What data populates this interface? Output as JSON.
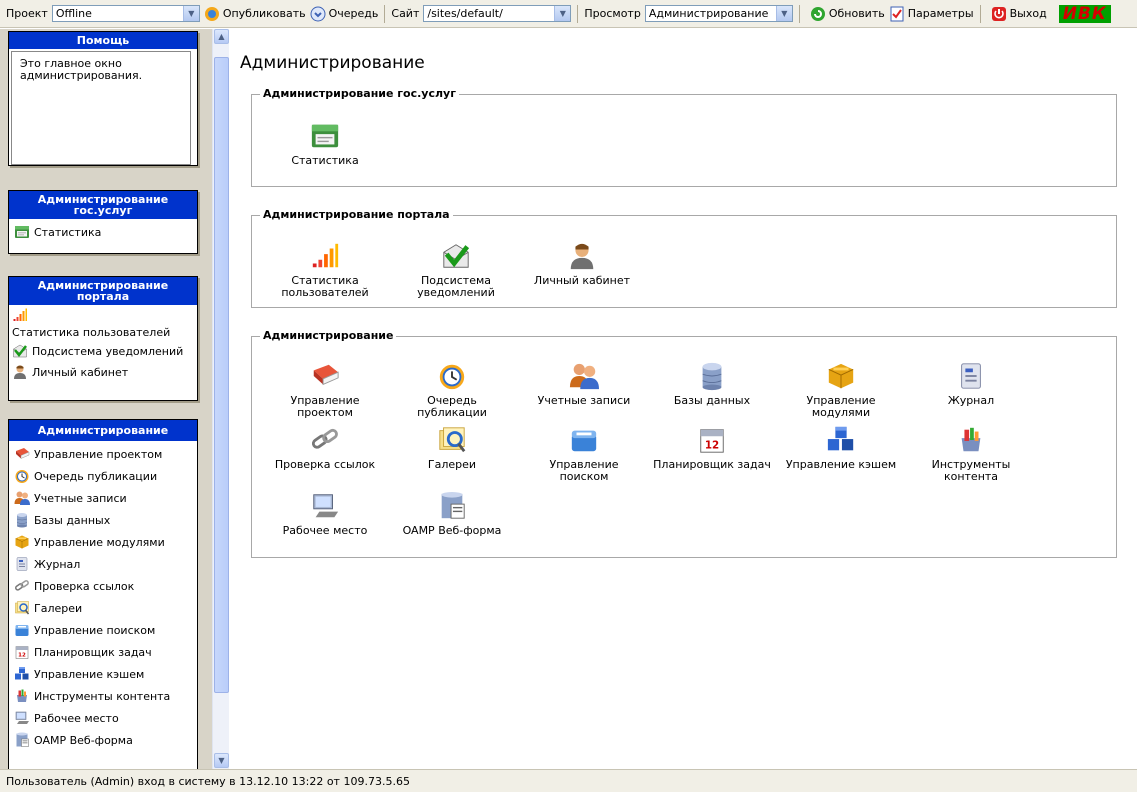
{
  "toolbar": {
    "project_label": "Проект",
    "project_value": "Offline",
    "publish_label": "Опубликовать",
    "queue_label": "Очередь",
    "site_label": "Сайт",
    "site_value": "/sites/default/",
    "view_label": "Просмотр",
    "view_value": "Администрирование",
    "refresh_label": "Обновить",
    "params_label": "Параметры",
    "exit_label": "Выход",
    "logo_text": "ИВК"
  },
  "sidebar": {
    "help": {
      "title": "Помощь",
      "text": "Это главное окно администрирования."
    },
    "gos": {
      "title": "Администрирование гос.услуг",
      "items": [
        {
          "label": "Статистика",
          "icon": "statistics-icon"
        }
      ]
    },
    "portal": {
      "title": "Администрирование портала",
      "items": [
        {
          "label": "Статистика пользователей",
          "icon": "bar-chart-icon"
        },
        {
          "label": "Подсистема уведомлений",
          "icon": "notify-icon"
        },
        {
          "label": "Личный кабинет",
          "icon": "user-icon"
        }
      ]
    },
    "admin": {
      "title": "Администрирование",
      "items": [
        {
          "label": "Управление проектом",
          "icon": "book-icon"
        },
        {
          "label": "Очередь публикации",
          "icon": "clock-icon"
        },
        {
          "label": "Учетные записи",
          "icon": "users-icon"
        },
        {
          "label": "Базы данных",
          "icon": "database-icon"
        },
        {
          "label": "Управление модулями",
          "icon": "modules-icon"
        },
        {
          "label": "Журнал",
          "icon": "journal-icon"
        },
        {
          "label": "Проверка ссылок",
          "icon": "link-icon"
        },
        {
          "label": "Галереи",
          "icon": "gallery-icon"
        },
        {
          "label": "Управление поиском",
          "icon": "search-mgmt-icon"
        },
        {
          "label": "Планировщик задач",
          "icon": "calendar-icon"
        },
        {
          "label": "Управление кэшем",
          "icon": "cache-icon"
        },
        {
          "label": "Инструменты контента",
          "icon": "tools-icon"
        },
        {
          "label": "Рабочее место",
          "icon": "workstation-icon"
        },
        {
          "label": "OAMP Веб-форма",
          "icon": "webform-icon"
        }
      ]
    }
  },
  "main": {
    "title": "Администрирование",
    "sections": [
      {
        "legend": "Администрирование гос.услуг",
        "tiles": [
          {
            "label": "Статистика"
          }
        ]
      },
      {
        "legend": "Администрирование портала",
        "tiles": [
          {
            "label": "Статистика пользователей"
          },
          {
            "label": "Подсистема уведомлений"
          },
          {
            "label": "Личный кабинет"
          }
        ]
      },
      {
        "legend": "Администрирование",
        "tiles": [
          {
            "label": "Управление проектом"
          },
          {
            "label": "Очередь публикации"
          },
          {
            "label": "Учетные записи"
          },
          {
            "label": "Базы данных"
          },
          {
            "label": "Управление модулями"
          },
          {
            "label": "Журнал"
          },
          {
            "label": "Проверка ссылок"
          },
          {
            "label": "Галереи"
          },
          {
            "label": "Управление поиском"
          },
          {
            "label": "Планировщик задач"
          },
          {
            "label": "Управление кэшем"
          },
          {
            "label": "Инструменты контента"
          },
          {
            "label": "Рабочее место"
          },
          {
            "label": "OAMP Веб-форма"
          }
        ]
      }
    ]
  },
  "status": {
    "text": "Пользователь (Admin) вход в систему в 13.12.10 13:22 от 109.73.5.65"
  },
  "colors": {
    "header_blue": "#0033cc",
    "sidebar_bg": "#d8d4c8",
    "toolbar_bg": "#f1efe6",
    "logo_red": "#d40000",
    "logo_green": "#00a000"
  }
}
